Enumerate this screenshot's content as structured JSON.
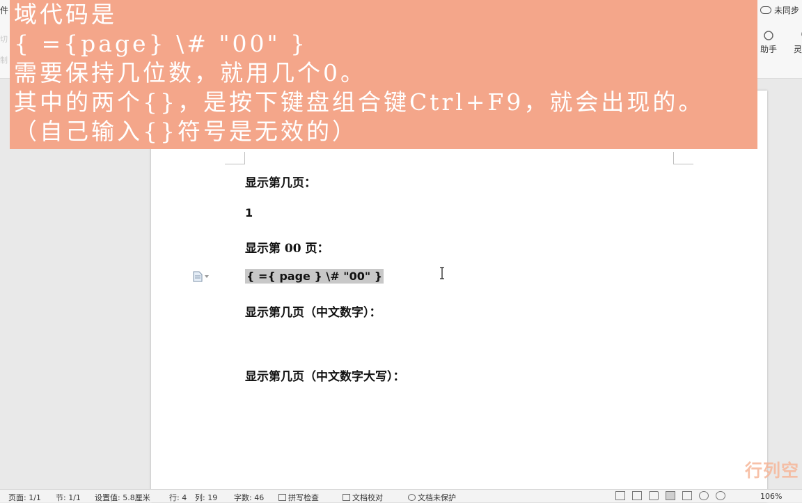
{
  "toolbar": {
    "left_labels": [
      "件",
      "切",
      "制"
    ],
    "sync_label": "未同步",
    "tools": [
      {
        "label": "助手",
        "icon": "assistant-icon"
      },
      {
        "label": "灵感国",
        "icon": "lightbulb-icon"
      }
    ]
  },
  "overlay": {
    "lines": [
      "域代码是",
      "{ ={page} \\# \"00\" }",
      "需要保持几位数，就用几个0。",
      "其中的两个{}，是按下键盘组合键Ctrl+F9，就会出现的。",
      "（自己输入{}符号是无效的）"
    ],
    "background": "#f4a68a"
  },
  "document": {
    "lines": [
      "显示第几页：",
      "1",
      "显示第 00 页：",
      "{ ={ page } \\# \"00\" }",
      "显示第几页（中文数字）：",
      "显示第几页（中文数字大写）："
    ]
  },
  "watermark": "行列空",
  "statusbar": {
    "page": "页面: 1/1",
    "section": "节: 1/1",
    "setting": "设置值: 5.8厘米",
    "row": "行: 4",
    "col": "列: 19",
    "words": "字数: 46",
    "spell": "拼写检查",
    "proof": "文档校对",
    "protect": "文档未保护",
    "zoom": "106%"
  }
}
